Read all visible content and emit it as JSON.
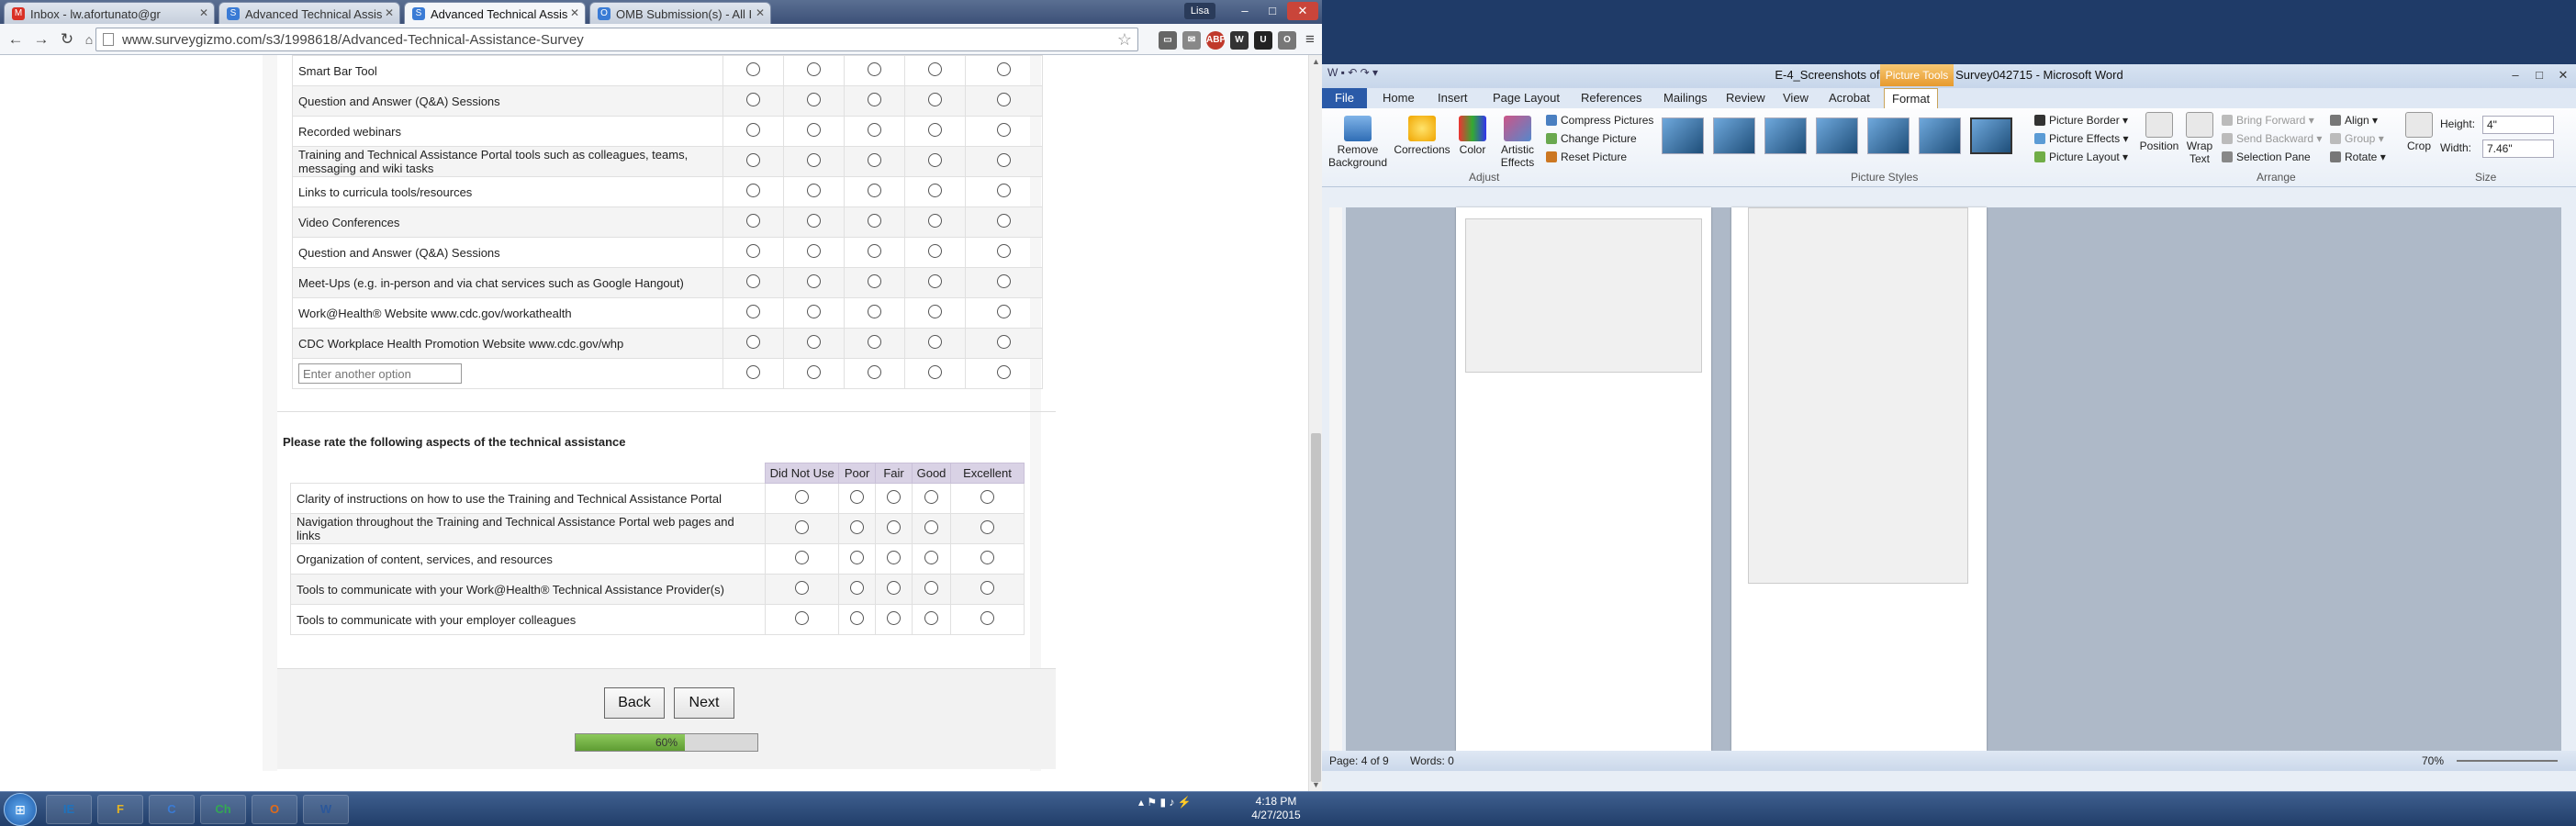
{
  "browser": {
    "tabs": [
      {
        "label": "Inbox - lw.afortunato@gr",
        "color": "#d93025",
        "icon": "M"
      },
      {
        "label": "Advanced Technical Assis",
        "color": "#3a7bd5",
        "icon": "S"
      },
      {
        "label": "Advanced Technical Assis",
        "color": "#3a7bd5",
        "icon": "S"
      },
      {
        "label": "OMB Submission(s) - All I",
        "color": "#3a7bd5",
        "icon": "O"
      }
    ],
    "user": "Lisa",
    "url": "www.surveygizmo.com/s3/1998618/Advanced-Technical-Assistance-Survey",
    "extensions": [
      {
        "label": "ABP",
        "color": "#c0392b"
      },
      {
        "label": "W",
        "color": "#333"
      },
      {
        "label": "U",
        "color": "#222"
      },
      {
        "label": "O",
        "color": "#777"
      }
    ]
  },
  "survey": {
    "q1_rows": [
      "Smart Bar Tool",
      "Question and Answer (Q&A) Sessions",
      "Recorded webinars",
      "Training and Technical Assistance Portal tools such as colleagues, teams, messaging and wiki tasks",
      "Links to curricula tools/resources",
      "Video Conferences",
      "Question and Answer (Q&A) Sessions",
      "Meet-Ups (e.g. in-person and via chat services such as Google Hangout)",
      "Work@Health® Website www.cdc.gov/workathealth",
      "CDC Workplace Health Promotion Website www.cdc.gov/whp"
    ],
    "q1_other_placeholder": "Enter another option",
    "q2_title": "Please rate the following aspects of the technical assistance",
    "q2_columns": [
      "Did Not Use",
      "Poor",
      "Fair",
      "Good",
      "Excellent"
    ],
    "q2_rows": [
      "Clarity of instructions on how to use the Training and Technical Assistance Portal",
      "Navigation throughout the Training and Technical Assistance Portal web pages and links",
      "Organization of content, services, and resources",
      "Tools to communicate with your Work@Health® Technical Assistance Provider(s)",
      "Tools to communicate with your employer colleagues"
    ],
    "back_label": "Back",
    "next_label": "Next",
    "progress_percent": 60,
    "progress_text": "60%"
  },
  "word": {
    "title": "E-4_Screenshots of Advanced TA Survey042715 - Microsoft Word",
    "picture_tools": "Picture Tools",
    "tabs": [
      "File",
      "Home",
      "Insert",
      "Page Layout",
      "References",
      "Mailings",
      "Review",
      "View",
      "Acrobat",
      "Format"
    ],
    "adjust": {
      "remove_background": "Remove Background",
      "corrections": "Corrections",
      "color": "Color",
      "artistic": "Artistic Effects",
      "compress": "Compress Pictures",
      "change": "Change Picture",
      "reset": "Reset Picture",
      "group_label": "Adjust"
    },
    "styles": {
      "border": "Picture Border",
      "effects": "Picture Effects",
      "layout": "Picture Layout",
      "group_label": "Picture Styles"
    },
    "arrange": {
      "position": "Position",
      "wrap": "Wrap Text",
      "forward": "Bring Forward",
      "backward": "Send Backward",
      "selection": "Selection Pane",
      "align": "Align",
      "group": "Group",
      "rotate": "Rotate",
      "group_label": "Arrange"
    },
    "size": {
      "crop": "Crop",
      "height_label": "Height:",
      "height": "4\"",
      "width_label": "Width:",
      "width": "7.46\"",
      "group_label": "Size"
    },
    "status": {
      "page": "Page: 4 of 9",
      "words": "Words: 0",
      "zoom": "70%"
    }
  },
  "taskbar": {
    "apps": [
      {
        "label": "IE",
        "color": "#1e73be"
      },
      {
        "label": "F",
        "color": "#e6b422"
      },
      {
        "label": "C",
        "color": "#3a7bd5"
      },
      {
        "label": "Ch",
        "color": "#34a853"
      },
      {
        "label": "O",
        "color": "#e06b1a"
      },
      {
        "label": "W",
        "color": "#2b579a"
      }
    ],
    "time": "4:18 PM",
    "date": "4/27/2015"
  }
}
